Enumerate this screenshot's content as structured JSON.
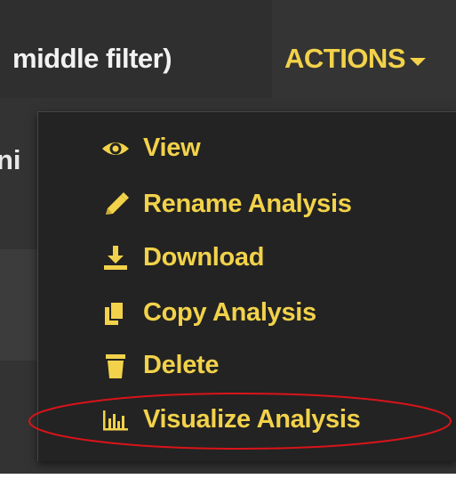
{
  "header": {
    "title": "middle filter)",
    "actions_label": "ACTIONS"
  },
  "background": {
    "fragment_text": "ni"
  },
  "menu": {
    "items": [
      {
        "label": "View",
        "icon": "eye-icon"
      },
      {
        "label": "Rename Analysis",
        "icon": "pencil-icon"
      },
      {
        "label": "Download",
        "icon": "download-icon"
      },
      {
        "label": "Copy Analysis",
        "icon": "copy-icon"
      },
      {
        "label": "Delete",
        "icon": "trash-icon"
      },
      {
        "label": "Visualize Analysis",
        "icon": "bar-chart-icon"
      }
    ]
  },
  "annotation": {
    "highlight_target": "Visualize Analysis",
    "color": "#d9141a"
  },
  "colors": {
    "accent": "#f2d24a",
    "menu_background": "#232323",
    "page_background": "#333333"
  }
}
